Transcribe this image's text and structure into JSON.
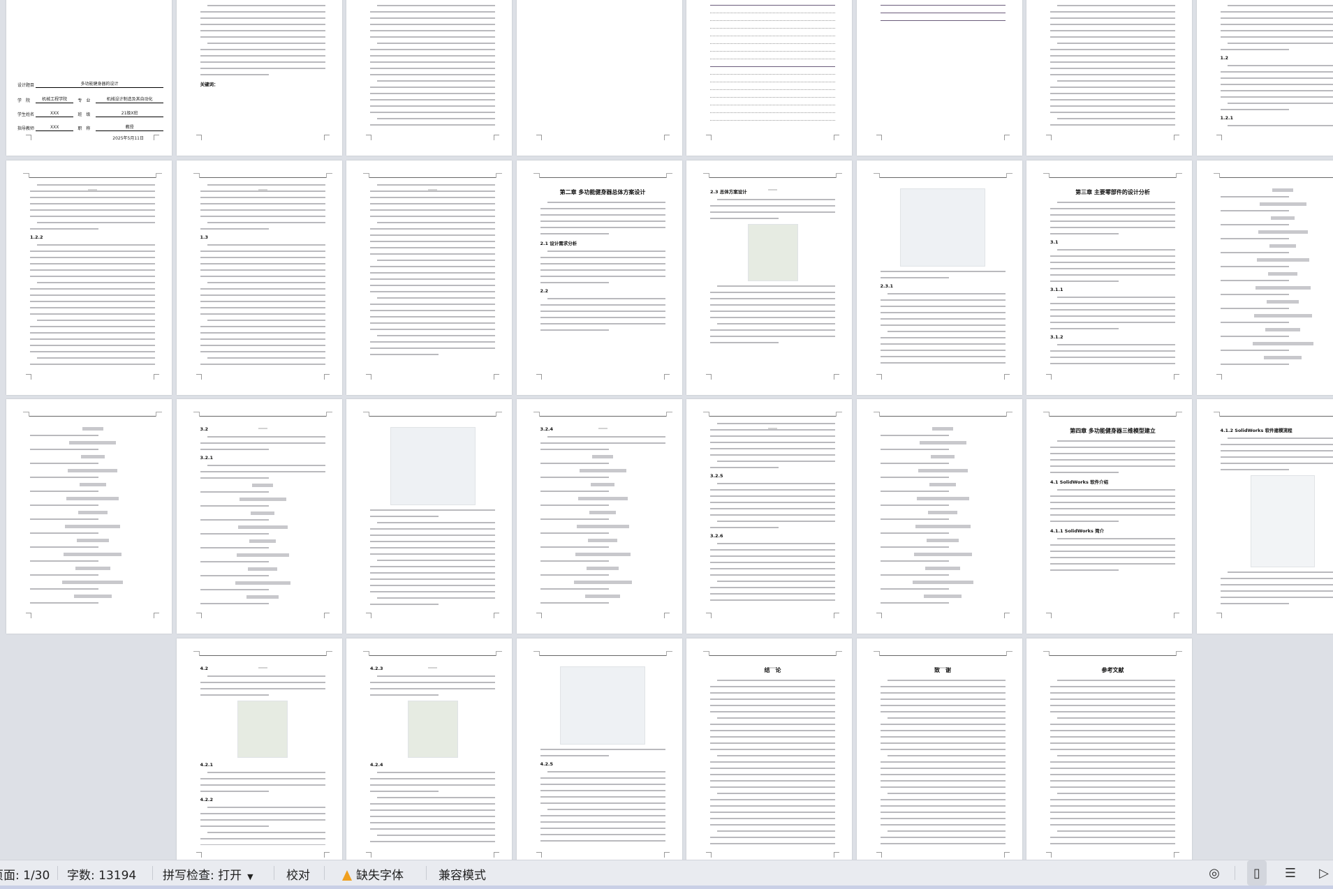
{
  "app": {
    "view": "multi-page"
  },
  "cover": {
    "title_label": "设计题目",
    "title_value": "多功能健身器的设计",
    "college_label": "学　院",
    "college_value": "机械工程学院",
    "major_label": "专　业",
    "major_value": "机械设计制造及其自动化",
    "student_label": "学生姓名",
    "student_value": "XXX",
    "class_label": "班　级",
    "class_value": "21级X班",
    "advisor_label": "指导教师",
    "advisor_value": "XXX",
    "rank_label": "职　称",
    "rank_value": "教授",
    "date": "2025年5月11日"
  },
  "abstract_cn": {
    "keywords_label": "关键词："
  },
  "pages": [
    {
      "kind": "cover"
    },
    {
      "kind": "abstract-cn"
    },
    {
      "kind": "abstract-en"
    },
    {
      "kind": "blank"
    },
    {
      "kind": "toc"
    },
    {
      "kind": "toc-end"
    },
    {
      "kind": "text"
    },
    {
      "kind": "text",
      "headings": [
        "1.2",
        "1.2.1"
      ]
    },
    {
      "kind": "text",
      "headings": [
        "1.2.2"
      ]
    },
    {
      "kind": "text",
      "headings": [
        "1.3"
      ]
    },
    {
      "kind": "text"
    },
    {
      "kind": "chapter",
      "headings": [
        "第二章 多功能健身器总体方案设计",
        "2.1 设计需求分析",
        "2.2"
      ]
    },
    {
      "kind": "text-figure",
      "headings": [
        "2.3 总体方案设计"
      ]
    },
    {
      "kind": "figure-text",
      "headings": [
        "2.3.1"
      ]
    },
    {
      "kind": "chapter",
      "headings": [
        "第三章 主要零部件的设计分析",
        "3.1",
        "3.1.1",
        "3.1.2"
      ]
    },
    {
      "kind": "formula"
    },
    {
      "kind": "formula"
    },
    {
      "kind": "formula",
      "headings": [
        "3.2",
        "3.2.1"
      ]
    },
    {
      "kind": "figure-text"
    },
    {
      "kind": "formula",
      "headings": [
        "3.2.4"
      ]
    },
    {
      "kind": "text",
      "headings": [
        "3.2.5",
        "3.2.6"
      ]
    },
    {
      "kind": "formula"
    },
    {
      "kind": "chapter",
      "headings": [
        "第四章 多功能健身器三维模型建立",
        "4.1 SolidWorks 软件介绍",
        "4.1.1 SolidWorks 简介"
      ]
    },
    {
      "kind": "text-diagram",
      "headings": [
        "4.1.2 SolidWorks 软件建模流程"
      ]
    },
    {
      "kind": "text-figure",
      "headings": [
        "4.2",
        "4.2.1",
        "4.2.2"
      ]
    },
    {
      "kind": "text-figure",
      "headings": [
        "4.2.3",
        "4.2.4"
      ]
    },
    {
      "kind": "figure-text",
      "headings": [
        "4.2.5"
      ]
    },
    {
      "kind": "chapter",
      "headings": [
        "结　论"
      ]
    },
    {
      "kind": "chapter",
      "headings": [
        "致　谢"
      ]
    },
    {
      "kind": "refs",
      "headings": [
        "参考文献"
      ]
    }
  ],
  "status": {
    "page": "页面: 1/30",
    "words": "字数: 13194",
    "spellcheck": "拼写检查: 打开",
    "proofread": "校对",
    "missing_font": "缺失字体",
    "compat_mode": "兼容模式"
  },
  "icons": {
    "eye": "eye-icon",
    "page_view": "page-view-icon",
    "outline": "outline-icon",
    "play": "play-icon",
    "warning": "warning-icon",
    "dropdown": "chevron-down-icon"
  },
  "colors": {
    "accent": "#2f6fd6",
    "warning": "#f0a020",
    "background": "#dde0e6"
  }
}
